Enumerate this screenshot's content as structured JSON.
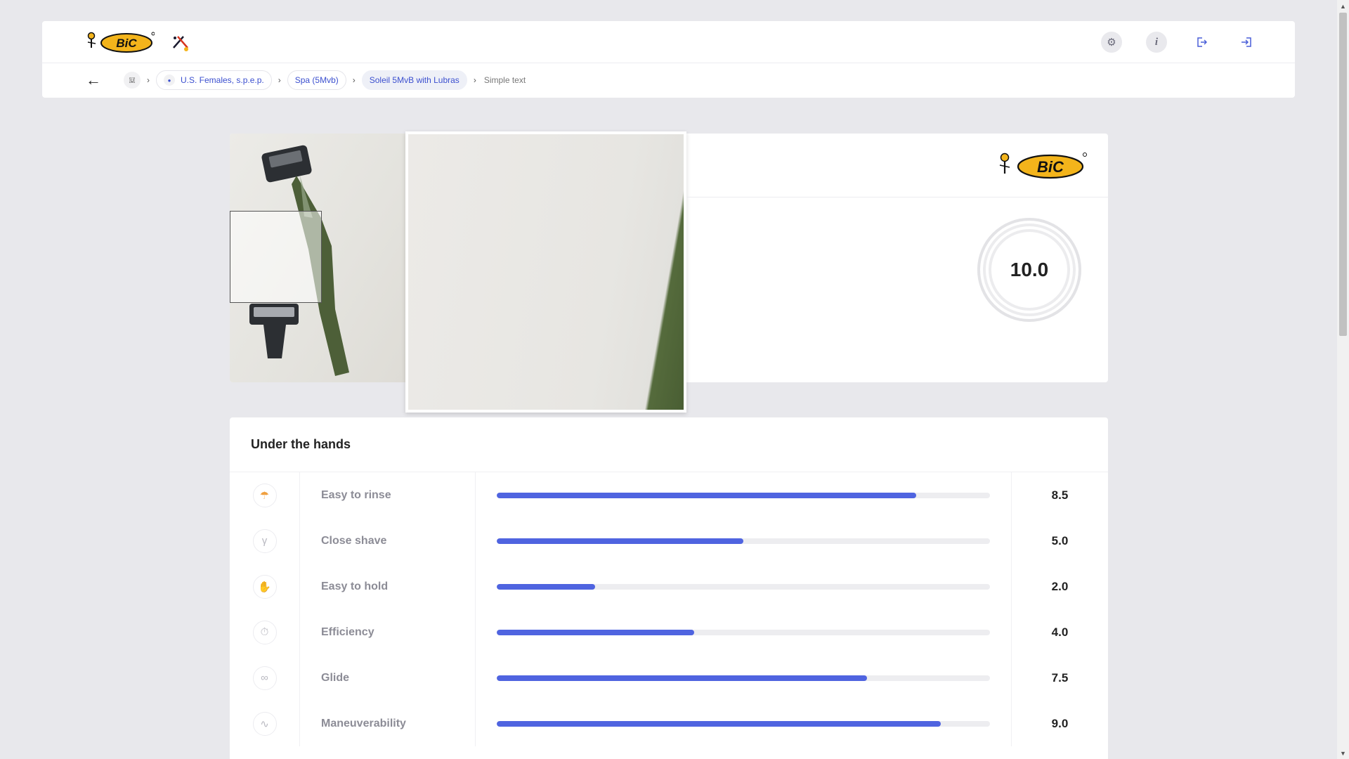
{
  "header": {
    "brand_logo_text": "BiC",
    "icons": [
      "settings-icon",
      "info-icon",
      "logout-icon",
      "login-icon"
    ]
  },
  "breadcrumb": {
    "items": [
      {
        "label": "U.S. Females, s.p.e.p."
      },
      {
        "label": "Spa (5Mvb)"
      },
      {
        "label": "Soleil 5MvB with Lubras"
      }
    ],
    "current": "Simple text"
  },
  "product": {
    "brand_logo_text": "BiC",
    "score": "10.0",
    "score_fraction": 1.0
  },
  "attributes": {
    "title": "Under the hands",
    "rows": [
      {
        "label": "Easy to rinse",
        "value": "8.5",
        "fill": 0.85,
        "icon": "shower-icon"
      },
      {
        "label": "Close shave",
        "value": "5.0",
        "fill": 0.5,
        "icon": "razor-blade-icon"
      },
      {
        "label": "Easy to hold",
        "value": "2.0",
        "fill": 0.2,
        "icon": "hand-icon"
      },
      {
        "label": "Efficiency",
        "value": "4.0",
        "fill": 0.4,
        "icon": "stopwatch-icon"
      },
      {
        "label": "Glide",
        "value": "7.5",
        "fill": 0.75,
        "icon": "glide-icon"
      },
      {
        "label": "Maneuverability",
        "value": "9.0",
        "fill": 0.9,
        "icon": "maneuver-icon"
      }
    ]
  },
  "colors": {
    "accent": "#4f64e0",
    "track": "#ededf0",
    "background": "#e8e8ec"
  }
}
